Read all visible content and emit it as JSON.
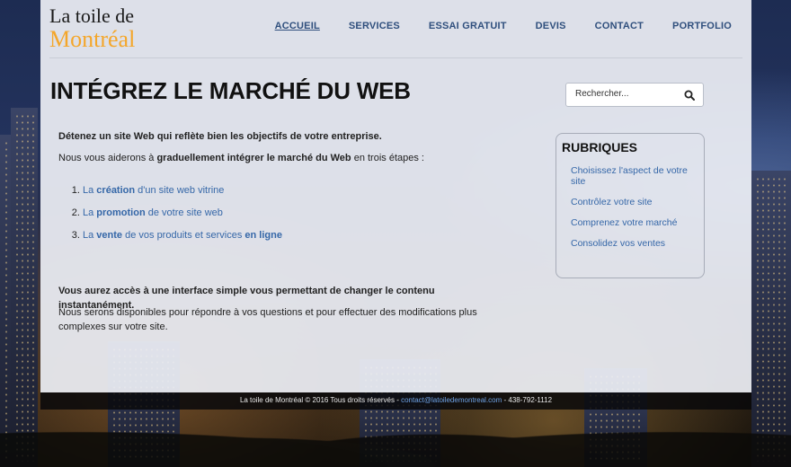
{
  "logo": {
    "line1": "La toile de",
    "line2": "Montréal"
  },
  "nav": [
    {
      "label": "ACCUEIL",
      "active": true
    },
    {
      "label": "SERVICES"
    },
    {
      "label": "ESSAI GRATUIT"
    },
    {
      "label": "DEVIS"
    },
    {
      "label": "CONTACT"
    },
    {
      "label": "PORTFOLIO"
    }
  ],
  "main": {
    "title": "INTÉGREZ LE MARCHÉ DU WEB",
    "p1": "Détenez un site Web qui reflète bien les objectifs de votre entreprise.",
    "p2_pre": "Nous vous aiderons à ",
    "p2_bold": "graduellement intégrer le marché du Web",
    "p2_post": " en trois étapes :",
    "steps": [
      {
        "pre": "La ",
        "bold": "création",
        "post": " d'un site web vitrine",
        "tail": ""
      },
      {
        "pre": "La ",
        "bold": "promotion",
        "post": " de votre site web",
        "tail": ""
      },
      {
        "pre": "La ",
        "bold": "vente",
        "post": " de vos produits et services ",
        "tail": "en ligne"
      }
    ],
    "p3": "Vous aurez accès à une interface simple vous permettant de changer le contenu instantanément.",
    "p4": "Nous serons disponibles pour répondre à vos questions et pour effectuer des modifications plus complexes sur votre site."
  },
  "search": {
    "placeholder": "Rechercher...",
    "icon": "search-icon"
  },
  "rubriques": {
    "title": "RUBRIQUES",
    "items": [
      "Choisissez l'aspect de votre site",
      "Contrôlez votre site",
      "Comprenez votre marché",
      "Consolidez vos ventes"
    ]
  },
  "footer": {
    "text": "La toile de Montréal © 2016 Tous droits réservés - ",
    "email": "contact@latoiledemontreal.com",
    "phone": " - 438-792-1112"
  },
  "colors": {
    "accent": "#f4a62a",
    "link": "#3567a8",
    "nav": "#2f4f7d"
  }
}
